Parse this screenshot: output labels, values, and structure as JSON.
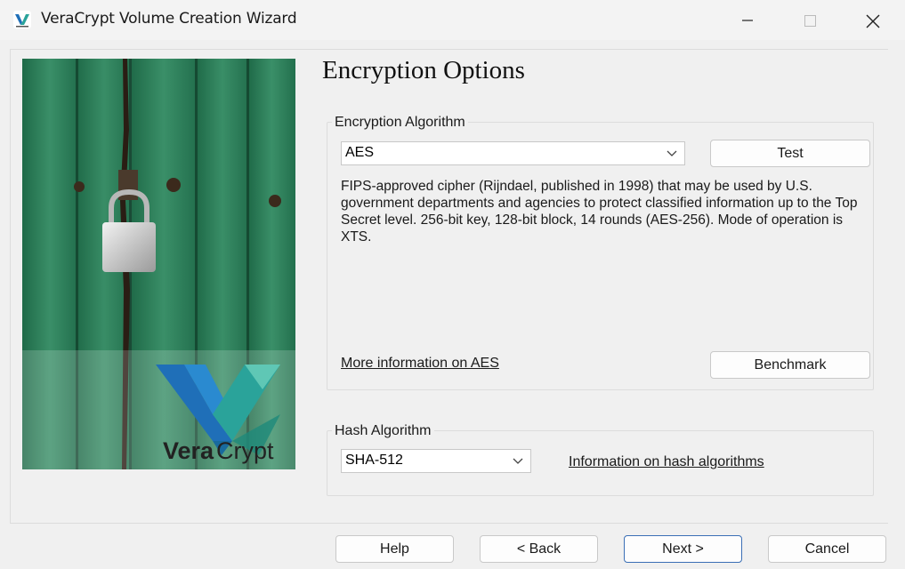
{
  "window": {
    "title": "VeraCrypt Volume Creation Wizard",
    "icon": "veracrypt-app-icon"
  },
  "page": {
    "heading": "Encryption Options"
  },
  "sidebar_image": {
    "logo_text_part1": "Vera",
    "logo_text_part2": "Crypt"
  },
  "encryption": {
    "group_label": "Encryption Algorithm",
    "selected": "AES",
    "test_label": "Test",
    "description": "FIPS-approved cipher (Rijndael, published in 1998) that may be used by U.S. government departments and agencies to protect classified information up to the Top Secret level. 256-bit key, 128-bit block, 14 rounds (AES-256). Mode of operation is XTS.",
    "more_info_link": "More information on AES",
    "benchmark_label": "Benchmark"
  },
  "hash": {
    "group_label": "Hash Algorithm",
    "selected": "SHA-512",
    "info_link": "Information on hash algorithms"
  },
  "footer": {
    "help": "Help",
    "back": "< Back",
    "next": "Next >",
    "cancel": "Cancel"
  },
  "colors": {
    "accent_border": "#3b6fb6",
    "door_green": "#2f7d5a",
    "logo_blue": "#1f6fb8",
    "logo_teal": "#2aa39a"
  }
}
